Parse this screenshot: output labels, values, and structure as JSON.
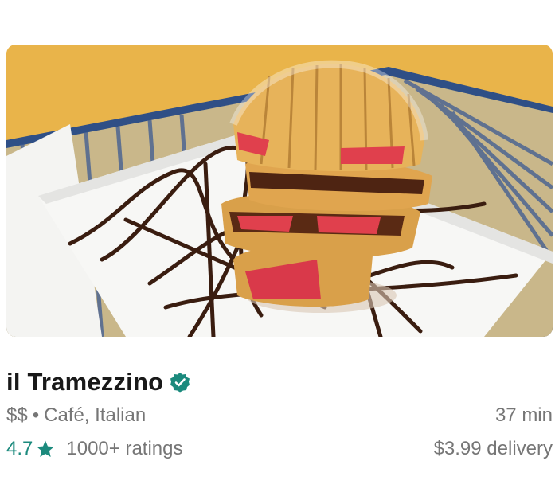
{
  "store": {
    "name": "il Tramezzino",
    "verified_icon": "verified-check-icon",
    "price_range": "$$",
    "separator": "•",
    "cuisine": "Café, Italian",
    "eta": "37 min",
    "rating": "4.7",
    "rating_icon": "star-icon",
    "ratings_count": "1000+ ratings",
    "delivery_fee": "$3.99 delivery",
    "accent_color": "#1b8a7d"
  }
}
